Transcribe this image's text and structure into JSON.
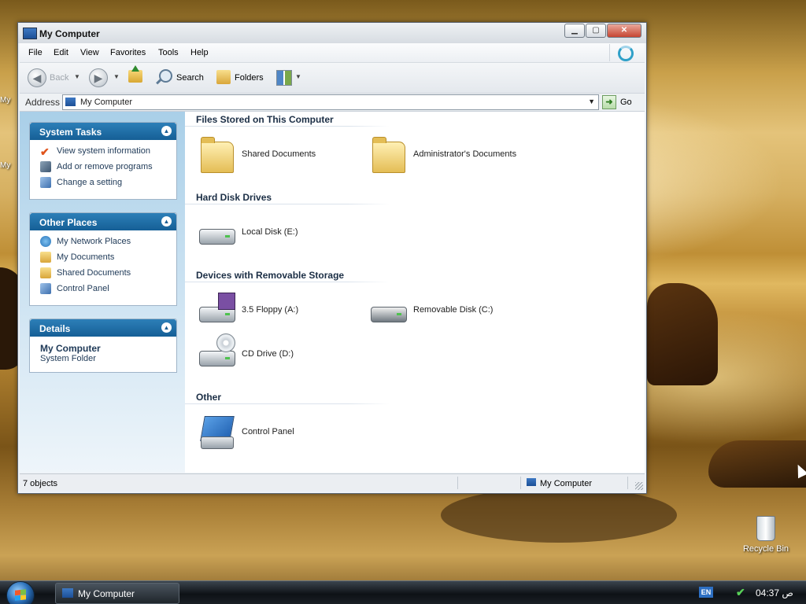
{
  "desktop": {
    "recycle_bin_label": "Recycle Bin",
    "left_labels": [
      "My",
      "My"
    ]
  },
  "window": {
    "title": "My Computer",
    "menu": [
      "File",
      "Edit",
      "View",
      "Favorites",
      "Tools",
      "Help"
    ],
    "toolbar": {
      "back_label": "Back",
      "search_label": "Search",
      "folders_label": "Folders"
    },
    "address": {
      "label": "Address",
      "value": "My Computer",
      "go_label": "Go"
    },
    "task_panes": {
      "system_tasks": {
        "title": "System Tasks",
        "items": [
          "View system information",
          "Add or remove programs",
          "Change a setting"
        ]
      },
      "other_places": {
        "title": "Other Places",
        "items": [
          "My Network Places",
          "My Documents",
          "Shared Documents",
          "Control Panel"
        ]
      },
      "details": {
        "title": "Details",
        "name": "My Computer",
        "type": "System Folder"
      }
    },
    "groups": {
      "files": {
        "title": "Files Stored on This Computer",
        "items": [
          "Shared Documents",
          "Administrator's Documents"
        ]
      },
      "hdd": {
        "title": "Hard Disk Drives",
        "items": [
          "Local Disk (E:)"
        ]
      },
      "removable": {
        "title": "Devices with Removable Storage",
        "items": [
          "3.5 Floppy (A:)",
          "Removable Disk (C:)",
          "CD Drive (D:)"
        ]
      },
      "other": {
        "title": "Other",
        "items": [
          "Control Panel"
        ]
      }
    },
    "status": {
      "objects": "7 objects",
      "location": "My Computer"
    }
  },
  "taskbar": {
    "task_button_label": "My Computer",
    "language": "EN",
    "clock": "04:37 ص"
  },
  "colors": {
    "task_pane_header": "#155f96",
    "link_text": "#1e3957",
    "window_frame": "#5b6470"
  }
}
